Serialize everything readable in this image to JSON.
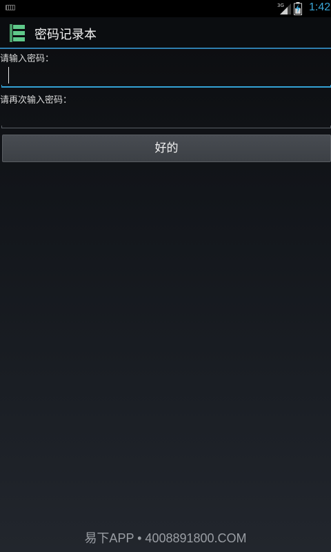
{
  "status_bar": {
    "time": "1:42",
    "network_label": "3G",
    "keyboard_icon": "keyboard-icon",
    "signal_icon": "signal-icon",
    "battery_icon": "battery-charging-icon"
  },
  "action_bar": {
    "title": "密码记录本",
    "app_icon": "notebook-app-icon",
    "accent_color": "#2f7fb0"
  },
  "form": {
    "password_label": "请输入密码：",
    "password_value": "",
    "confirm_label": "请再次输入密码：",
    "confirm_value": "",
    "ok_button": "好的",
    "focus_color": "#33a3d6"
  },
  "watermark": "易下APP • 4008891800.COM"
}
